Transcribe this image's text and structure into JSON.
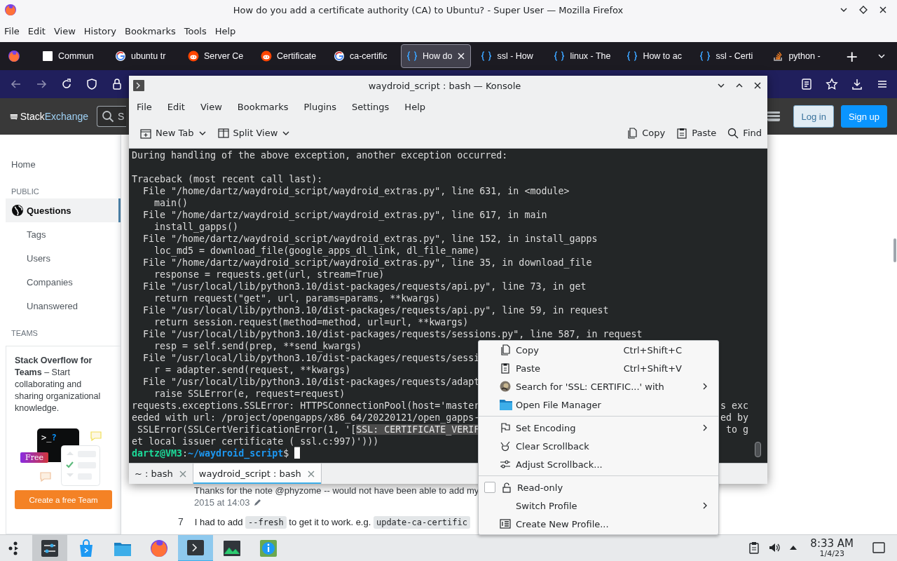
{
  "browser": {
    "title": "How do you add a certificate authority (CA) to Ubuntu? - Super User — Mozilla Firefox",
    "menu": [
      "File",
      "Edit",
      "View",
      "History",
      "Bookmarks",
      "Tools",
      "Help"
    ],
    "tabs": [
      {
        "label": "Commun",
        "selected": false
      },
      {
        "label": "ubuntu tr",
        "selected": false
      },
      {
        "label": "Server Ce",
        "selected": false
      },
      {
        "label": "Certificate",
        "selected": false
      },
      {
        "label": "ca-certific",
        "selected": false
      },
      {
        "label": "How do",
        "selected": true
      },
      {
        "label": "ssl - How",
        "selected": false
      },
      {
        "label": "linux - The",
        "selected": false
      },
      {
        "label": "How to ac",
        "selected": false
      },
      {
        "label": "ssl - Certi",
        "selected": false
      },
      {
        "label": "python - ",
        "selected": false
      }
    ],
    "new_tab": "+"
  },
  "site_header": {
    "logo_first": "Stack",
    "logo_second": "Exchange",
    "search": {
      "placeholder": "S"
    },
    "login": "Log in",
    "signup": "Sign up"
  },
  "sidebar": {
    "home": {
      "label": "Home",
      "selected": false
    },
    "public": {
      "heading": "PUBLIC",
      "items": [
        {
          "label": "Questions",
          "selected": true
        },
        {
          "label": "Tags",
          "selected": false
        },
        {
          "label": "Users",
          "selected": false
        },
        {
          "label": "Companies",
          "selected": false
        },
        {
          "label": "Unanswered",
          "selected": false
        }
      ]
    },
    "teams": {
      "heading": "TEAMS",
      "text": "**Stack Overflow for Teams** – Start collaborating and sharing organizational knowledge.",
      "prompt": ">_",
      "mark": "?",
      "badge": "Free",
      "button": "Create a free Team"
    }
  },
  "post": {
    "comment": "Thanks for the note @phyzome -- would not have been able to add my",
    "comment_date": "2015 at 14:03",
    "answer_votes": "7",
    "answer": [
      {
        "kind": "text",
        "text": "I had to add "
      },
      {
        "kind": "code",
        "text": "--fresh"
      },
      {
        "kind": "text",
        "text": " to get it to work. e.g. "
      },
      {
        "kind": "code",
        "text": "update-ca-certific"
      }
    ]
  },
  "konsole": {
    "title": "waydroid_script : bash — Konsole",
    "menu": [
      "File",
      "Edit",
      "View",
      "Bookmarks",
      "Plugins",
      "Settings",
      "Help"
    ],
    "toolbar_left": [
      {
        "label": "New Tab",
        "dropdown": true
      },
      {
        "label": "Split View",
        "dropdown": true
      }
    ],
    "toolbar_right": [
      {
        "label": "Copy"
      },
      {
        "label": "Paste"
      },
      {
        "label": "Find"
      }
    ],
    "terminal": {
      "blocks": [
        [
          {
            "text": "During handling of the above exception, another exception occurred:"
          }
        ],
        [
          {
            "text": "Traceback (most recent call last):"
          },
          {
            "text": "  File \"/home/dartz/waydroid_script/waydroid_extras.py\", line 631, in <module>"
          },
          {
            "text": "    main()"
          },
          {
            "text": "  File \"/home/dartz/waydroid_script/waydroid_extras.py\", line 617, in main"
          },
          {
            "text": "    install_gapps()"
          },
          {
            "text": "  File \"/home/dartz/waydroid_script/waydroid_extras.py\", line 152, in install_gapps"
          },
          {
            "text": "    loc_md5 = download_file(google_apps_dl_link, dl_file_name)"
          },
          {
            "text": "  File \"/home/dartz/waydroid_script/waydroid_extras.py\", line 35, in download_file"
          },
          {
            "text": "    response = requests.get(url, stream=True)"
          },
          {
            "text": "  File \"/usr/local/lib/python3.10/dist-packages/requests/api.py\", line 73, in get"
          },
          {
            "text": "    return request(\"get\", url, params=params, **kwargs)"
          },
          {
            "text": "  File \"/usr/local/lib/python3.10/dist-packages/requests/api.py\", line 59, in request"
          },
          {
            "text": "    return session.request(method=method, url=url, **kwargs)"
          },
          {
            "text": "  File \"/usr/local/lib/python3.10/dist-packages/requests/sessions.py\", line 587, in request"
          },
          {
            "text": "    resp = self.send(prep, **send_kwargs)"
          },
          {
            "text": "  File \"/usr/local/lib/python3.10/dist-packages/requests/sessi"
          },
          {
            "text": "    r = adapter.send(request, **kwargs)"
          },
          {
            "text": "  File \"/usr/local/lib/python3.10/dist-packages/requests/adapt"
          },
          {
            "text": "    raise SSLError(e, request=request)"
          },
          {
            "text": "requests.exceptions.SSLError: HTTPSConnectionPool(host='master",
            "tail": "s exc"
          },
          {
            "text": "eeded with url: /project/opengapps/x86_64/20220121/open_gapps-",
            "tail": "ed by"
          },
          {
            "text": " SSLError(SSLCertVerificationError(1, '[",
            "selection": "SSL: CERTIFICATE_VERIF",
            "tail": "to g"
          },
          {
            "text": "et local issuer certificate (_ssl.c:997)')))"
          }
        ]
      ],
      "prompt": {
        "user": "dartz@VM3",
        "separator": ":",
        "path": "~/waydroid_script",
        "symbol": "$"
      },
      "cursor": true
    },
    "tabs": [
      {
        "label": "~ : bash",
        "selected": false
      },
      {
        "label": "waydroid_script : bash",
        "selected": true
      }
    ]
  },
  "context_menu": {
    "items": [
      {
        "kind": "item",
        "label": "Copy",
        "shortcut": "Ctrl+Shift+C",
        "submenu": false
      },
      {
        "kind": "item",
        "label": "Paste",
        "shortcut": "Ctrl+Shift+V",
        "submenu": false
      },
      {
        "kind": "item",
        "label": "Search for 'SSL: CERTIFIC...' with",
        "submenu": true
      },
      {
        "kind": "item",
        "label": "Open File Manager",
        "submenu": false
      },
      {
        "kind": "separator"
      },
      {
        "kind": "item",
        "label": "Set Encoding",
        "submenu": true
      },
      {
        "kind": "item",
        "label": "Clear Scrollback",
        "submenu": false
      },
      {
        "kind": "item",
        "label": "Adjust Scrollback...",
        "submenu": false
      },
      {
        "kind": "separator"
      },
      {
        "kind": "checkbox",
        "label": "Read-only",
        "checked": false,
        "submenu": false
      },
      {
        "kind": "item",
        "label": "Switch Profile",
        "submenu": true
      },
      {
        "kind": "item",
        "label": "Create New Profile...",
        "submenu": false
      }
    ]
  },
  "taskbar": {
    "apps": [
      {
        "selected": false,
        "hovered": true
      },
      {
        "selected": false,
        "hovered": false
      },
      {
        "selected": false,
        "hovered": false
      },
      {
        "selected": false,
        "hovered": false
      },
      {
        "selected": true,
        "hovered": false
      },
      {
        "selected": false,
        "hovered": false
      },
      {
        "selected": false,
        "hovered": false
      }
    ],
    "time": "8:33 AM",
    "date": "1/4/23"
  }
}
